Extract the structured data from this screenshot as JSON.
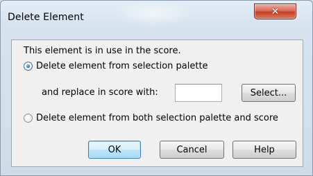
{
  "window": {
    "title": "Delete Element",
    "close_glyph": "✕",
    "close_icon": "close-icon"
  },
  "dialog": {
    "message": "This element is in use in the score.",
    "options": [
      {
        "label": "Delete element from selection palette",
        "selected": true
      },
      {
        "label": "Delete element from both selection palette and score",
        "selected": false
      }
    ],
    "replace_label": "and replace in score with:",
    "replace_value": "",
    "select_button": "Select...",
    "ok_button": "OK",
    "cancel_button": "Cancel",
    "help_button": "Help"
  },
  "colors": {
    "accent": "#3c7fb1",
    "close_button": "#c3402a",
    "dialog_background": "#f0f0f0"
  }
}
